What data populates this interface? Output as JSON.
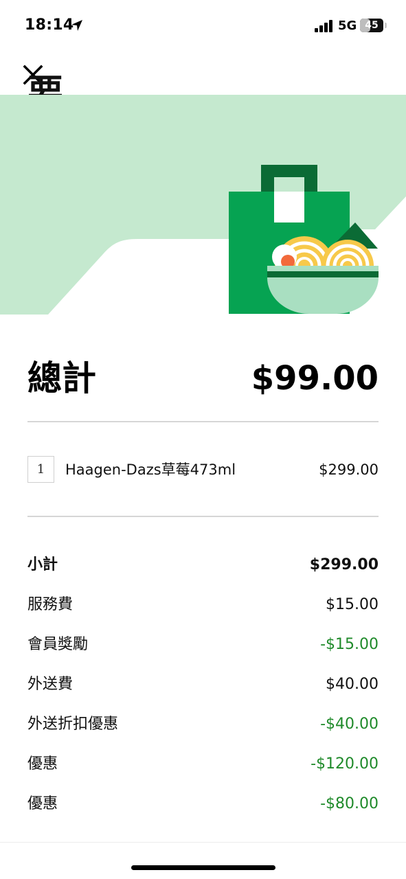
{
  "status_bar": {
    "time": "18:14",
    "network": "5G",
    "battery_level": "45",
    "battery_fraction": 0.45
  },
  "icons": {
    "location": "location-arrow-icon",
    "signal": "cellular-signal-icon",
    "close": "close-icon",
    "illustration": "grocery-bag-noodle-bowl-illustration"
  },
  "header": {
    "title_partial": "要"
  },
  "summary": {
    "total_label": "總計",
    "total_amount": "$99.00"
  },
  "items": [
    {
      "qty": "1",
      "name": "Haagen-Dazs草莓473ml",
      "price": "$299.00"
    }
  ],
  "fees": [
    {
      "label": "小計",
      "value": "$299.00",
      "style": "bold"
    },
    {
      "label": "服務費",
      "value": "$15.00",
      "style": "normal"
    },
    {
      "label": "會員獎勵",
      "value": "-$15.00",
      "style": "discount"
    },
    {
      "label": "外送費",
      "value": "$40.00",
      "style": "normal"
    },
    {
      "label": "外送折扣優惠",
      "value": "-$40.00",
      "style": "discount"
    },
    {
      "label": "優惠",
      "value": "-$120.00",
      "style": "discount"
    },
    {
      "label": "優惠",
      "value": "-$80.00",
      "style": "discount"
    }
  ],
  "colors": {
    "hero_mint": "#c5e9cf",
    "bag_green": "#06a352",
    "bag_dark_green": "#0b6b35",
    "bowl_mint": "#a9dfc1",
    "noodle_yellow": "#f7c94a",
    "discount_green": "#1f8a2a"
  }
}
